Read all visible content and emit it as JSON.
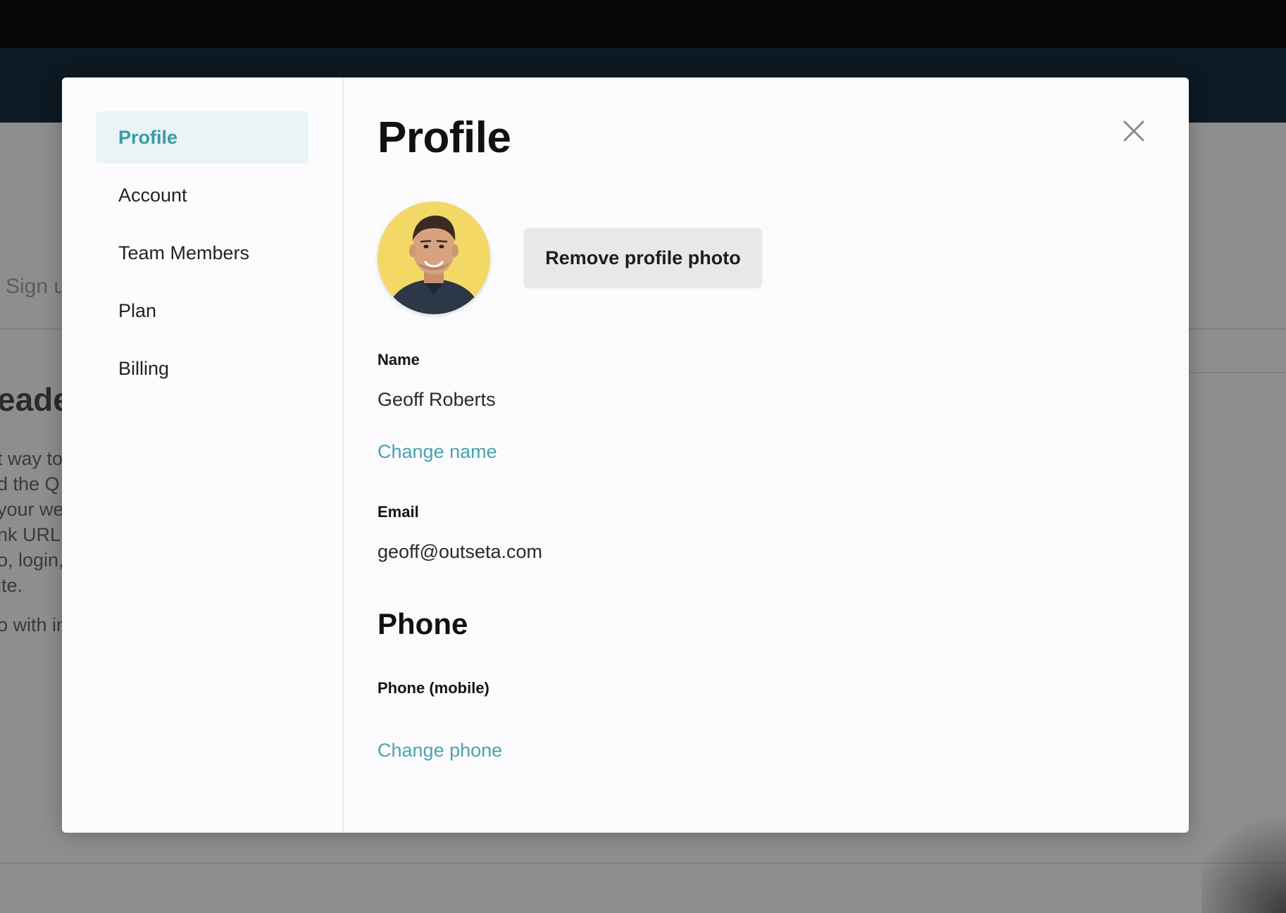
{
  "background": {
    "signup_text": "Sign u",
    "heading_fragment": "eade",
    "paragraph_lines": [
      "t way to",
      "d the Q",
      "your we",
      "nk URL",
      "o, login,",
      "ite."
    ],
    "extra_line": "o with in"
  },
  "sidebar": {
    "items": [
      {
        "label": "Profile",
        "active": true
      },
      {
        "label": "Account",
        "active": false
      },
      {
        "label": "Team Members",
        "active": false
      },
      {
        "label": "Plan",
        "active": false
      },
      {
        "label": "Billing",
        "active": false
      }
    ]
  },
  "main": {
    "title": "Profile",
    "close_icon": "close-icon",
    "remove_photo_label": "Remove profile photo",
    "name": {
      "label": "Name",
      "value": "Geoff Roberts",
      "change_link": "Change name"
    },
    "email": {
      "label": "Email",
      "value": "geoff@outseta.com"
    },
    "phone_section_title": "Phone",
    "phone": {
      "label": "Phone (mobile)",
      "change_link": "Change phone"
    }
  },
  "colors": {
    "accent": "#49a4ae",
    "active_nav_bg": "#eaf3f5",
    "avatar_bg": "#f3d866",
    "overlay": "#8e8e90"
  }
}
